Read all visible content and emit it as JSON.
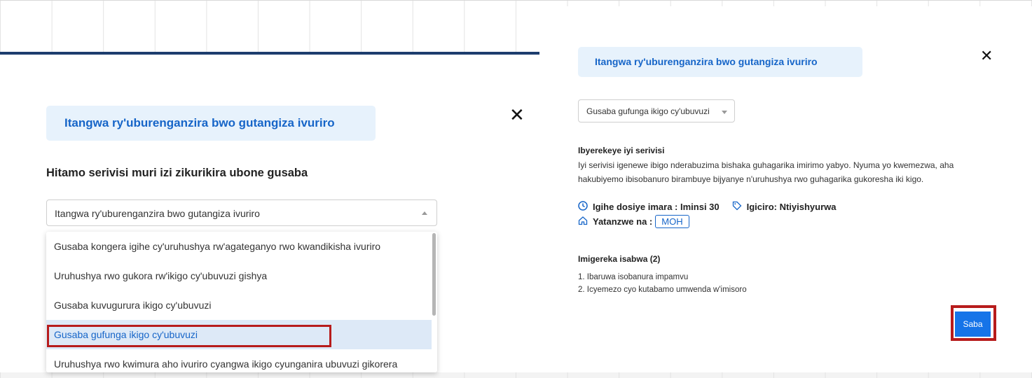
{
  "left_modal": {
    "title": "Itangwa ry'uburenganzira bwo gutangiza ivuriro",
    "close_label": "✕",
    "heading": "Hitamo serivisi muri izi zikurikira ubone gusaba",
    "select_value": "Itangwa ry'uburenganzira bwo gutangiza ivuriro",
    "dropdown_options": [
      "Gusaba kongera igihe cy'uruhushya rw'agateganyo rwo kwandikisha ivuriro",
      "Uruhushya rwo gukora rw'ikigo cy'ubuvuzi gishya",
      "Gusaba kuvugurura ikigo cy'ubuvuzi",
      "Gusaba gufunga ikigo cy'ubuvuzi",
      "Uruhushya rwo kwimura aho ivuriro cyangwa ikigo cyunganira ubuvuzi gikorera"
    ],
    "selected_option": "Gusaba gufunga ikigo cy'ubuvuzi"
  },
  "right_modal": {
    "title": "Itangwa ry'uburenganzira bwo gutangiza ivuriro",
    "close_label": "✕",
    "service_select": "Gusaba gufunga ikigo cy'ubuvuzi",
    "description_title": "Ibyerekeye iyi serivisi",
    "description_text": "Iyi serivisi igenewe ibigo nderabuzima bishaka guhagarika imirimo yabyo. Nyuma yo kwemezwa, aha hakubiyemo ibisobanuro birambuye bijyanye n'uruhushya rwo guhagarika gukoresha iki kigo.",
    "duration": "Igihe dosiye imara : Iminsi 30",
    "price": "Igiciro: Ntiyishyurwa",
    "issued_by_label": "Yatanzwe na :",
    "issued_by_value": "MOH",
    "requirements_title": "Imigereka isabwa (2)",
    "requirements": [
      "1. Ibaruwa isobanura impamvu",
      "2. Icyemezo cyo kutabamo umwenda w'imisoro"
    ],
    "submit_label": "Saba"
  },
  "icons": {
    "clock": "clock-icon",
    "tag": "tag-icon",
    "home": "home-icon"
  },
  "colors": {
    "accent": "#1665c8",
    "pill_bg": "#e7f2fc",
    "highlight": "#b71c1c",
    "button": "#1674e8"
  }
}
